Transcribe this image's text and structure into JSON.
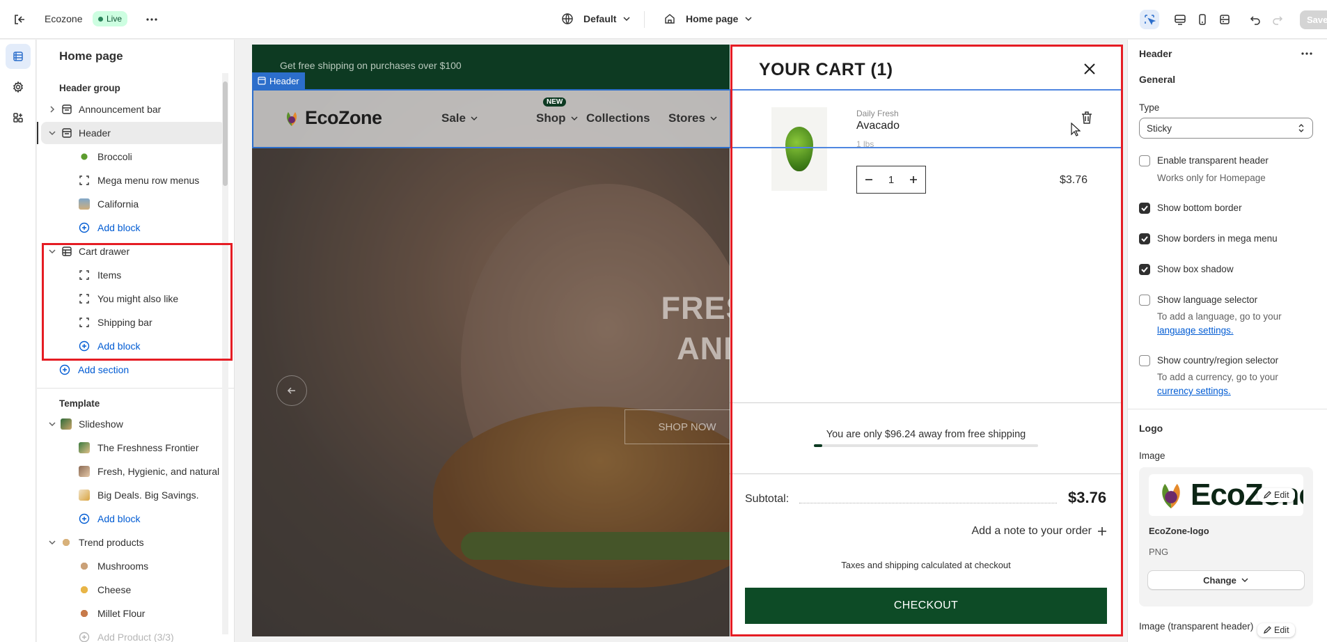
{
  "topbar": {
    "store_name": "Ecozone",
    "status": "Live",
    "theme": "Default",
    "page": "Home page",
    "save": "Save"
  },
  "sidebar": {
    "title": "Home page",
    "header_group": "Header group",
    "items": {
      "announcement": "Announcement bar",
      "header": "Header",
      "broccoli": "Broccoli",
      "mega": "Mega menu row menus",
      "california": "California",
      "add_block_1": "Add block",
      "cart_drawer": "Cart drawer",
      "items": "Items",
      "you_might": "You might also like",
      "shipping_bar": "Shipping bar",
      "add_block_2": "Add block",
      "add_section": "Add section",
      "template": "Template",
      "slideshow": "Slideshow",
      "slide1": "The Freshness Frontier",
      "slide2": "Fresh, Hygienic, and natural",
      "slide3": "Big Deals. Big Savings.",
      "add_block_3": "Add block",
      "trend": "Trend products",
      "mushrooms": "Mushrooms",
      "cheese": "Cheese",
      "millet": "Millet Flour",
      "add_product": "Add Product (3/3)"
    }
  },
  "preview": {
    "announcement": "Get free shipping on purchases over $100",
    "header_tag": "Header",
    "logo": "EcoZone",
    "nav": [
      "Sale",
      "Shop",
      "Collections",
      "Stores"
    ],
    "new_badge": "NEW",
    "hero_line1": "FRESH, HYG",
    "hero_line2": "AND NATU",
    "shop_now": "SHOP NOW",
    "cart": {
      "title": "YOUR CART (1)",
      "vendor": "Daily Fresh",
      "product": "Avacado",
      "variant": "1 lbs",
      "qty": "1",
      "price": "$3.76",
      "shipping_msg": "You are only $96.24 away from free shipping",
      "shipping_progress": 0.0376,
      "subtotal_label": "Subtotal:",
      "subtotal": "$3.76",
      "note": "Add a note to your order",
      "taxes": "Taxes and shipping calculated at checkout",
      "checkout": "CHECKOUT"
    }
  },
  "settings": {
    "title": "Header",
    "general": "General",
    "type_label": "Type",
    "type_value": "Sticky",
    "transparent": "Enable transparent header",
    "transparent_help": "Works only for Homepage",
    "bottom_border": "Show bottom border",
    "mega_borders": "Show borders in mega menu",
    "box_shadow": "Show box shadow",
    "language": "Show language selector",
    "language_help": "To add a language, go to your",
    "language_link": "language settings.",
    "country": "Show country/region selector",
    "country_help": "To add a currency, go to your",
    "country_link": "currency settings.",
    "logo": "Logo",
    "image": "Image",
    "logo_preview_text": "EcoZone",
    "edit": "Edit",
    "file_name": "EcoZone-logo",
    "file_type": "PNG",
    "change": "Change",
    "image_transparent": "Image (transparent header)"
  },
  "colors": {
    "accent_red": "#e51c23",
    "selection_blue": "#2c6ecb",
    "brand_green": "#0d4b26"
  }
}
